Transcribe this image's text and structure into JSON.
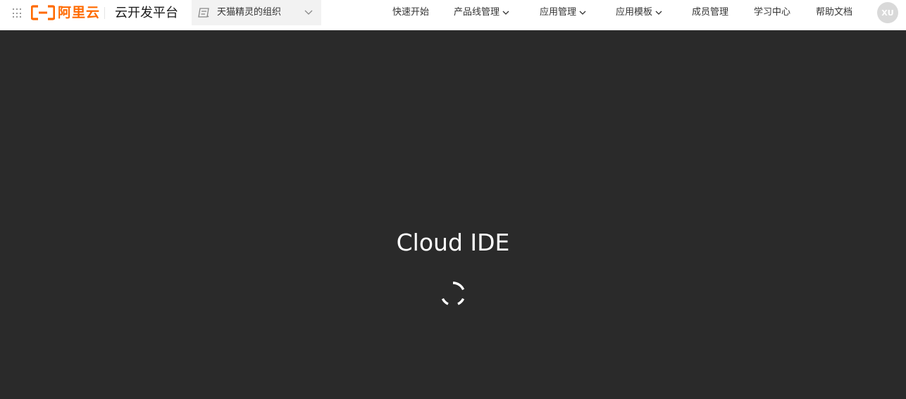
{
  "header": {
    "brand_text": "阿里云",
    "platform_title": "云开发平台",
    "org": {
      "name": "天猫精灵的组织",
      "icon": "org-switch-icon"
    },
    "nav": [
      {
        "label": "快速开始",
        "has_dropdown": false
      },
      {
        "label": "产品线管理",
        "has_dropdown": true
      },
      {
        "label": "应用管理",
        "has_dropdown": true
      },
      {
        "label": "应用模板",
        "has_dropdown": true
      },
      {
        "label": "成员管理",
        "has_dropdown": false
      },
      {
        "label": "学习中心",
        "has_dropdown": false
      },
      {
        "label": "帮助文档",
        "has_dropdown": false
      }
    ],
    "avatar_initials": "XU"
  },
  "main": {
    "loading_title": "Cloud IDE"
  },
  "colors": {
    "brand": "#ff6a00",
    "header_bg": "#ffffff",
    "main_bg": "#2a2a2a",
    "spinner": "#ffffff"
  }
}
